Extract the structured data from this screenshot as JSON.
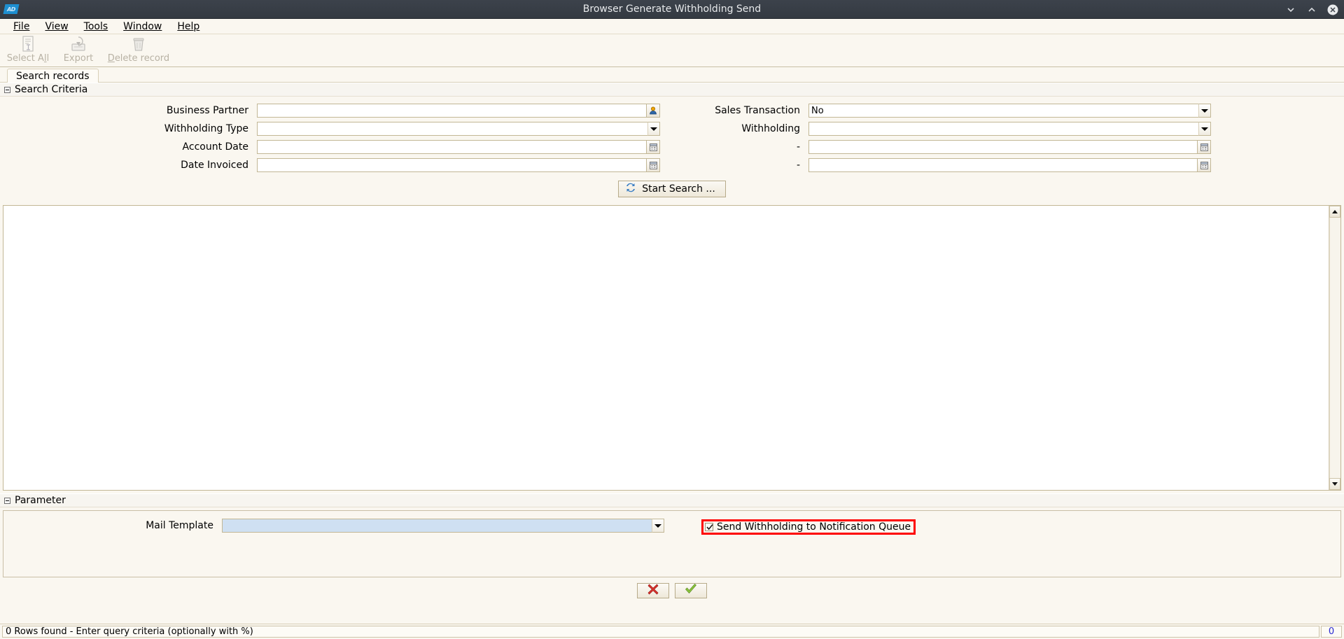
{
  "window": {
    "title": "Browser Generate Withholding Send",
    "logo_text": "AD",
    "controls": {
      "minimize": "minimize-icon",
      "maximize": "maximize-icon",
      "close": "close-icon"
    }
  },
  "menubar": {
    "items": [
      {
        "label": "File",
        "mnemonic": "F"
      },
      {
        "label": "View",
        "mnemonic": "V"
      },
      {
        "label": "Tools",
        "mnemonic": "T"
      },
      {
        "label": "Window",
        "mnemonic": "W"
      },
      {
        "label": "Help",
        "mnemonic": "H"
      }
    ]
  },
  "toolbar": {
    "buttons": [
      {
        "label": "Select All",
        "icon": "document-select-icon",
        "enabled": false
      },
      {
        "label": "Export",
        "icon": "export-disk-icon",
        "enabled": false
      },
      {
        "label": "Delete record",
        "icon": "trash-icon",
        "enabled": false
      }
    ]
  },
  "tabs": [
    {
      "label": "Search records",
      "active": true
    }
  ],
  "search_criteria": {
    "section_title": "Search Criteria",
    "collapsed": false,
    "fields_left": [
      {
        "label": "Business Partner",
        "value": "",
        "widget": "text-with-lookup",
        "button_icon": "lookup-person-icon"
      },
      {
        "label": "Withholding Type",
        "value": "",
        "widget": "combo",
        "button_icon": "chevron-down-icon"
      },
      {
        "label": "Account Date",
        "value": "",
        "widget": "text-with-calendar",
        "button_icon": "calendar-icon"
      },
      {
        "label": "Date Invoiced",
        "value": "",
        "widget": "text-with-calendar",
        "button_icon": "calendar-icon"
      }
    ],
    "fields_right": [
      {
        "label": "Sales Transaction",
        "value": "No",
        "widget": "combo",
        "button_icon": "chevron-down-icon"
      },
      {
        "label": "Withholding",
        "value": "",
        "widget": "combo",
        "button_icon": "chevron-down-icon"
      },
      {
        "label": "-",
        "value": "",
        "widget": "text-with-calendar",
        "button_icon": "calendar-icon"
      },
      {
        "label": "-",
        "value": "",
        "widget": "text-with-calendar",
        "button_icon": "calendar-icon"
      }
    ],
    "start_search_label": "Start Search ...",
    "start_search_icon": "refresh-icon"
  },
  "results": {
    "rows": [],
    "scrollbar": {
      "up": "scroll-up-arrow",
      "down": "scroll-down-arrow"
    }
  },
  "parameter": {
    "section_title": "Parameter",
    "collapsed": false,
    "mail_template": {
      "label": "Mail Template",
      "value": "",
      "widget": "combo",
      "focused": true
    },
    "send_checkbox": {
      "label": "Send Withholding to Notification Queue",
      "checked": true,
      "highlight_color": "#fe0000"
    }
  },
  "actions": {
    "cancel_icon": "red-x-icon",
    "ok_icon": "green-check-icon"
  },
  "statusbar": {
    "message": "0 Rows found - Enter query criteria (optionally with %)",
    "count": "0"
  }
}
